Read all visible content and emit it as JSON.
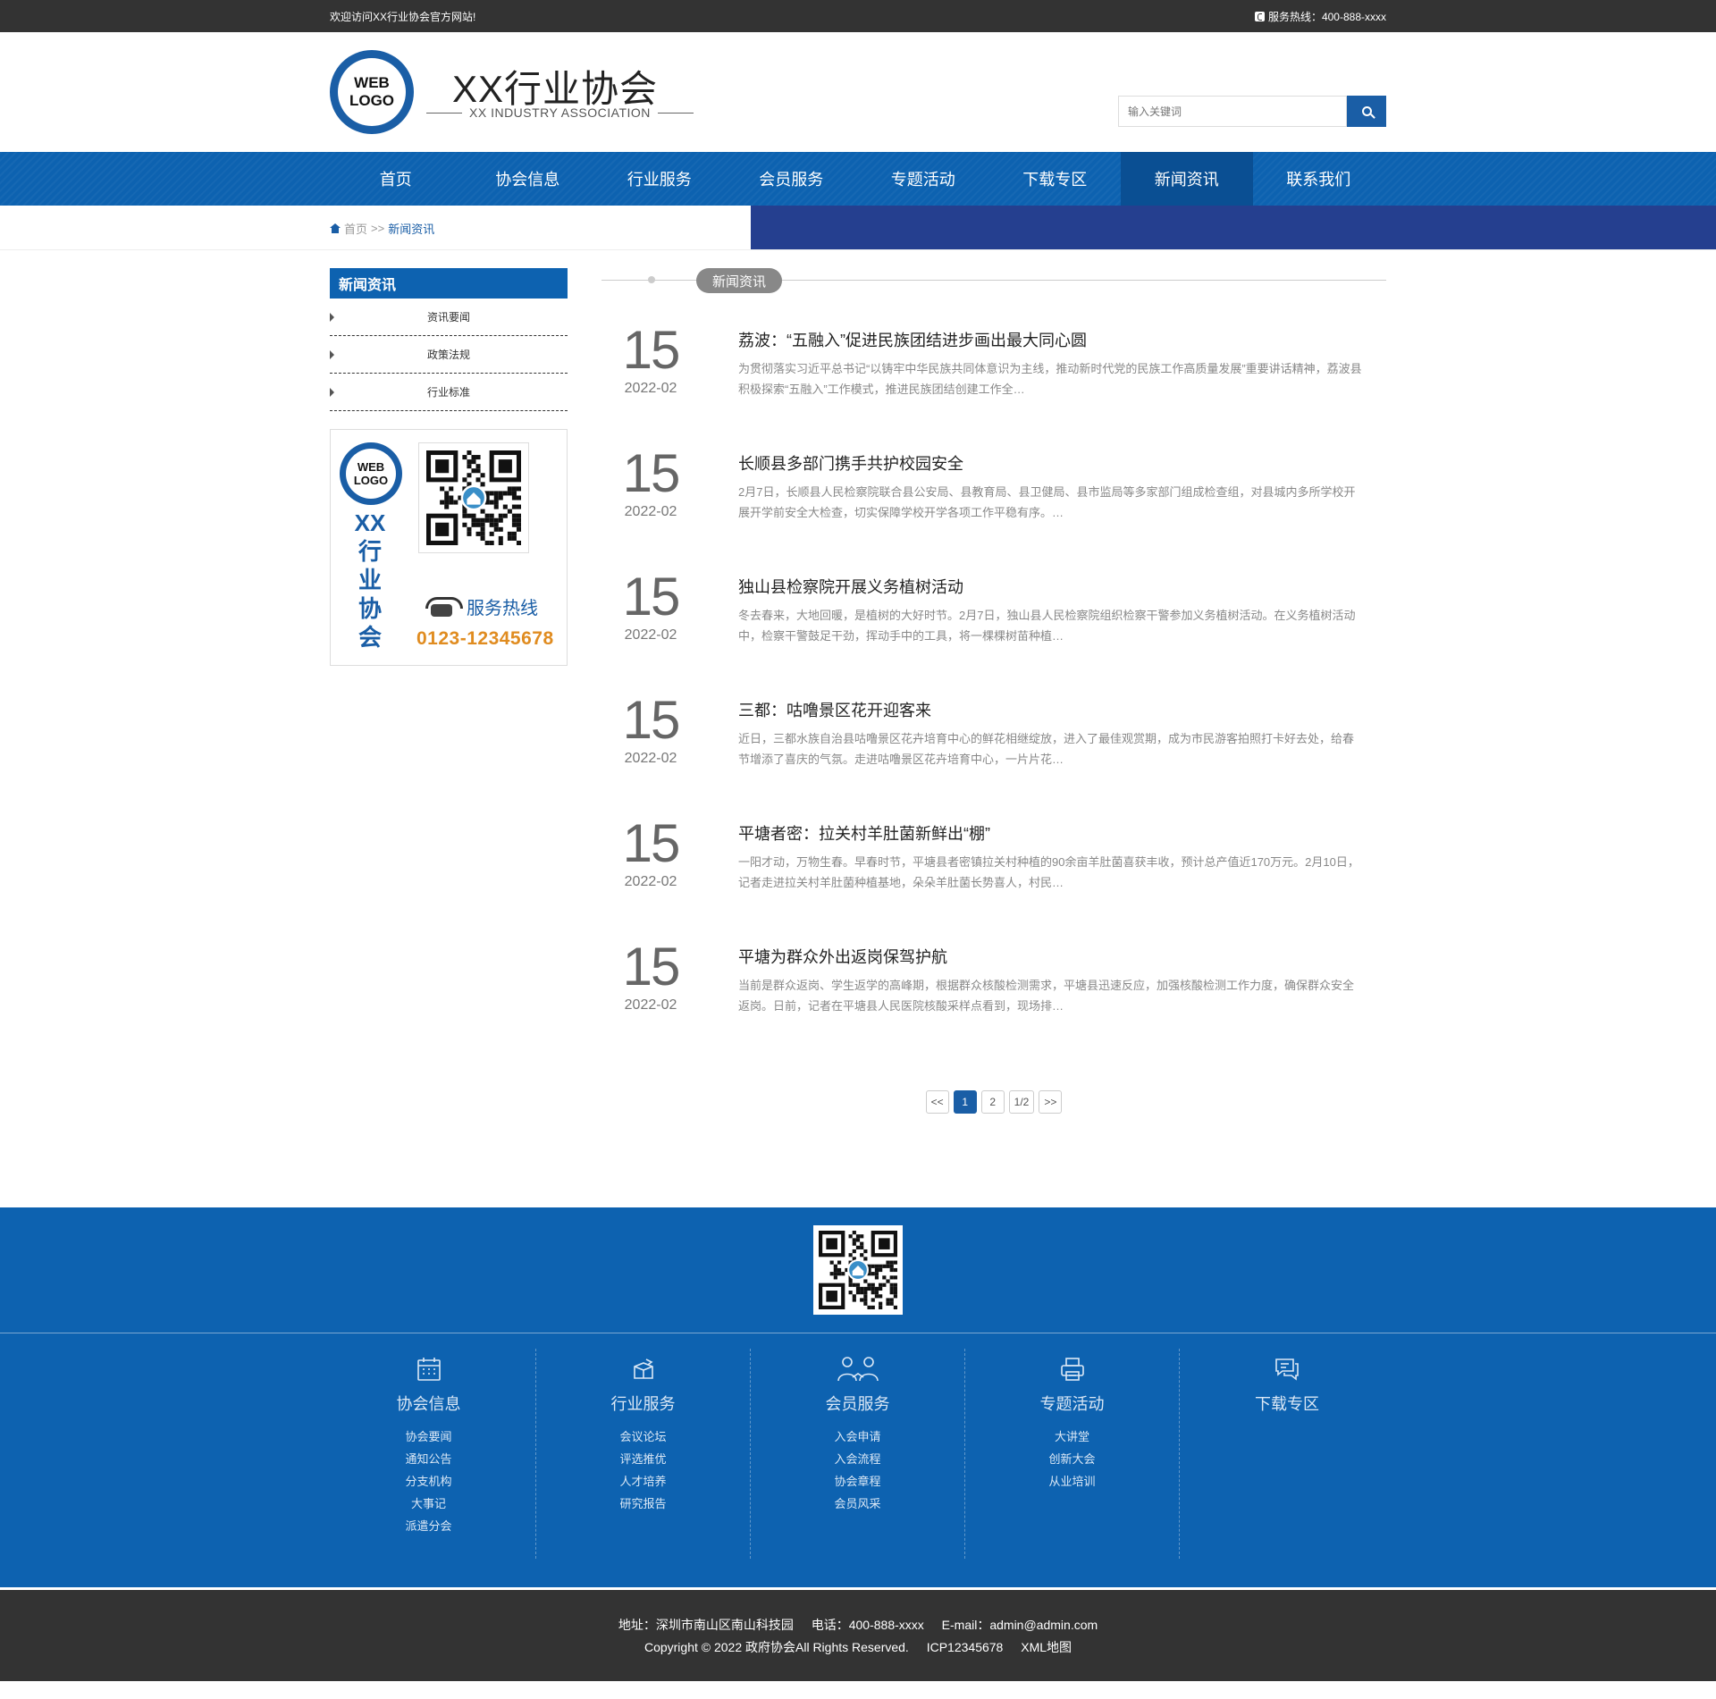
{
  "topbar": {
    "welcome": "欢迎访问XX行业协会官方网站!",
    "hotline": "服务热线：400-888-xxxx"
  },
  "header": {
    "logo_line1": "WEB",
    "logo_line2": "LOGO",
    "title": "XX行业协会",
    "subtitle": "XX INDUSTRY ASSOCIATION",
    "search_placeholder": "输入关键词"
  },
  "nav": [
    "首页",
    "协会信息",
    "行业服务",
    "会员服务",
    "专题活动",
    "下载专区",
    "新闻资讯",
    "联系我们"
  ],
  "breadcrumb": {
    "home": "首页",
    "sep": ">>",
    "current": "新闻资讯"
  },
  "sidebar": {
    "title": "新闻资讯",
    "items": [
      "资讯要闻",
      "政策法规",
      "行业标准"
    ],
    "promo_name": "XX行业协会",
    "promo_hot_label": "服务热线",
    "promo_hot_number": "0123-12345678"
  },
  "section_title": "新闻资讯",
  "news": [
    {
      "day": "15",
      "ym": "2022-02",
      "title": "荔波：“五融入”促进民族团结进步画出最大同心圆",
      "summary": "为贯彻落实习近平总书记“以铸牢中华民族共同体意识为主线，推动新时代党的民族工作高质量发展”重要讲话精神，荔波县积极探索“五融入”工作模式，推进民族团结创建工作全…"
    },
    {
      "day": "15",
      "ym": "2022-02",
      "title": "长顺县多部门携手共护校园安全",
      "summary": "2月7日，长顺县人民检察院联合县公安局、县教育局、县卫健局、县市监局等多家部门组成检查组，对县城内多所学校开展开学前安全大检查，切实保障学校开学各项工作平稳有序。…"
    },
    {
      "day": "15",
      "ym": "2022-02",
      "title": "独山县检察院开展义务植树活动",
      "summary": "冬去春来，大地回暖，是植树的大好时节。2月7日，独山县人民检察院组织检察干警参加义务植树活动。在义务植树活动中，检察干警鼓足干劲，挥动手中的工具，将一棵棵树苗种植…"
    },
    {
      "day": "15",
      "ym": "2022-02",
      "title": "三都：咕噜景区花开迎客来",
      "summary": "近日，三都水族自治县咕噜景区花卉培育中心的鲜花相继绽放，进入了最佳观赏期，成为市民游客拍照打卡好去处，给春节增添了喜庆的气氛。走进咕噜景区花卉培育中心，一片片花…"
    },
    {
      "day": "15",
      "ym": "2022-02",
      "title": "平塘者密：拉关村羊肚菌新鲜出“棚”",
      "summary": "一阳才动，万物生春。早春时节，平塘县者密镇拉关村种植的90余亩羊肚菌喜获丰收，预计总产值近170万元。2月10日，记者走进拉关村羊肚菌种植基地，朵朵羊肚菌长势喜人，村民…"
    },
    {
      "day": "15",
      "ym": "2022-02",
      "title": "平塘为群众外出返岗保驾护航",
      "summary": "当前是群众返岗、学生返学的高峰期，根据群众核酸检测需求，平塘县迅速反应，加强核酸检测工作力度，确保群众安全返岗。日前，记者在平塘县人民医院核酸采样点看到，现场排…"
    }
  ],
  "pager": {
    "prev": "<<",
    "pages": [
      "1",
      "2"
    ],
    "info": "1/2",
    "next": ">>"
  },
  "footer_cols": [
    {
      "title": "协会信息",
      "icon": "calendar-icon",
      "links": [
        "协会要闻",
        "通知公告",
        "分支机构",
        "大事记",
        "派遣分会"
      ]
    },
    {
      "title": "行业服务",
      "icon": "box-icon",
      "links": [
        "会议论坛",
        "评选推优",
        "人才培养",
        "研究报告"
      ]
    },
    {
      "title": "会员服务",
      "icon": "members-icon",
      "links": [
        "入会申请",
        "入会流程",
        "协会章程",
        "会员风采"
      ]
    },
    {
      "title": "专题活动",
      "icon": "printer-icon",
      "links": [
        "大讲堂",
        "创新大会",
        "从业培训"
      ]
    },
    {
      "title": "下载专区",
      "icon": "chat-icon",
      "links": []
    }
  ],
  "bottom": {
    "address": "地址：深圳市南山区南山科技园",
    "phone": "电话：400-888-xxxx",
    "email": "E-mail：admin@admin.com",
    "copyright": "Copyright © 2022 政府协会All Rights Reserved.",
    "icp": "ICP12345678",
    "xml": "XML地图"
  },
  "colors": {
    "primary": "#0d62b0",
    "dark": "#333333",
    "accent_orange": "#e08c20",
    "banner_right": "#253f8f"
  }
}
